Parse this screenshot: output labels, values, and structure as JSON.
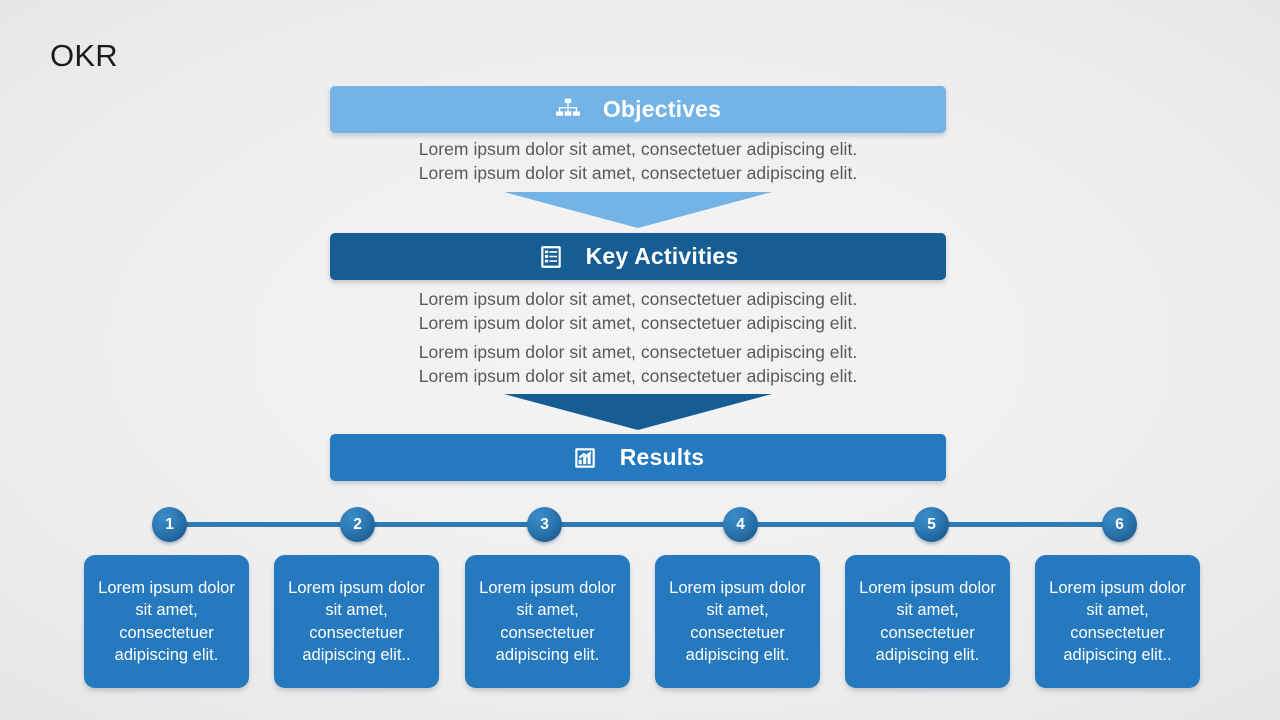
{
  "slide": {
    "title": "OKR"
  },
  "colors": {
    "objectives": "#74b3e5",
    "key_activities": "#155d93",
    "results": "#2579bf",
    "timeline_line": "#2e7ab5",
    "card": "#2579bf",
    "body_text": "#58585b",
    "title_text": "#1b1b1b",
    "background": "#efeff0"
  },
  "stages": [
    {
      "id": "objectives",
      "label": "Objectives",
      "icon": "org-chart-icon",
      "lines": [
        "Lorem ipsum dolor sit amet, consectetuer adipiscing elit.",
        "Lorem ipsum dolor sit amet, consectetuer adipiscing elit."
      ]
    },
    {
      "id": "key-activities",
      "label": "Key Activities",
      "icon": "list-icon",
      "lines": [
        "Lorem ipsum dolor sit amet, consectetuer adipiscing elit.",
        "Lorem ipsum dolor sit amet, consectetuer adipiscing elit.",
        "Lorem ipsum dolor sit amet, consectetuer adipiscing elit.",
        "Lorem ipsum dolor sit amet, consectetuer adipiscing elit."
      ]
    },
    {
      "id": "results",
      "label": "Results",
      "icon": "bar-chart-icon",
      "lines": []
    }
  ],
  "arrows": [
    {
      "id": "arrow-objectives-to-activities",
      "color": "#74b3e5"
    },
    {
      "id": "arrow-activities-to-results",
      "color": "#155d93"
    }
  ],
  "timeline": {
    "nodes": [
      {
        "number": "1"
      },
      {
        "number": "2"
      },
      {
        "number": "3"
      },
      {
        "number": "4"
      },
      {
        "number": "5"
      },
      {
        "number": "6"
      }
    ]
  },
  "cards": [
    {
      "text": "Lorem ipsum dolor sit amet, consectetuer adipiscing elit."
    },
    {
      "text": "Lorem ipsum dolor sit amet, consectetuer adipiscing elit.."
    },
    {
      "text": "Lorem ipsum dolor sit amet, consectetuer adipiscing elit."
    },
    {
      "text": "Lorem ipsum dolor sit amet, consectetuer adipiscing elit."
    },
    {
      "text": "Lorem ipsum dolor sit amet, consectetuer adipiscing elit."
    },
    {
      "text": "Lorem ipsum dolor sit amet, consectetuer adipiscing elit.."
    }
  ]
}
